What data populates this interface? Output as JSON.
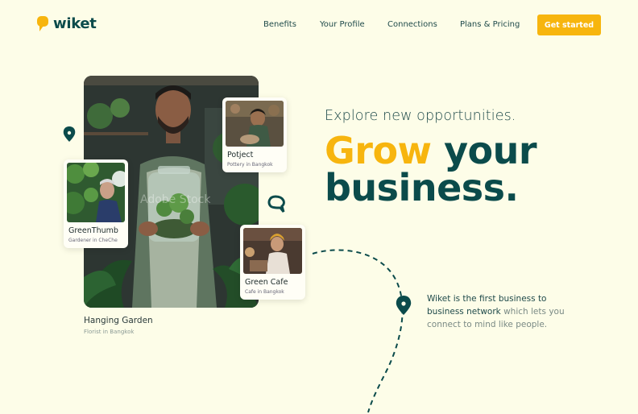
{
  "brand": {
    "name": "wiket",
    "accent": "#f7b50e",
    "primary": "#0b4b4b"
  },
  "nav": {
    "items": [
      "Benefits",
      "Your Profile",
      "Connections",
      "Plans & Pricing"
    ],
    "cta": "Get started"
  },
  "hero": {
    "tagline": "Explore new opportunities.",
    "headline_accent": "Grow",
    "headline_rest_1": "your",
    "headline_rest_2": "business.",
    "description_strong": "Wiket is the first business to business network",
    "description_rest": " which lets you connect to mind like people.",
    "main_profile": {
      "name": "Hanging Garden",
      "subtitle": "Florist in Bangkok"
    },
    "watermark": "Adobe Stock"
  },
  "cards": [
    {
      "name": "Potject",
      "subtitle": "Pottery in Bangkok"
    },
    {
      "name": "GreenThumb",
      "subtitle": "Gardener in CheChe"
    },
    {
      "name": "Green Cafe",
      "subtitle": "Cafe in Bangkok"
    }
  ],
  "icons": [
    "location-pin-icon",
    "chat-bubble-icon",
    "logo-icon"
  ]
}
